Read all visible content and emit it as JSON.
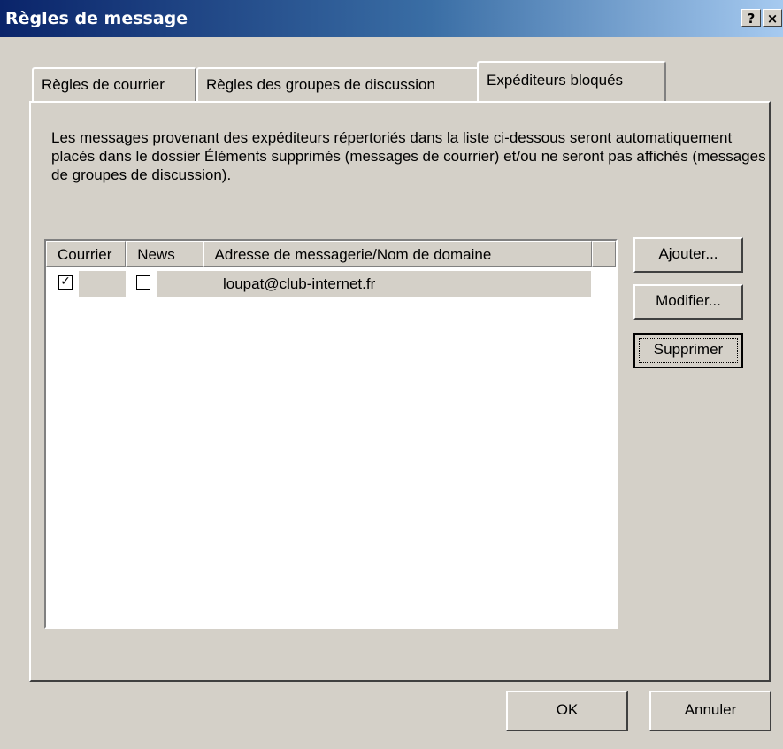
{
  "window": {
    "title": "Règles de message",
    "help_label": "?",
    "close_label": "×"
  },
  "tabs": [
    {
      "label": "Règles de courrier",
      "active": false
    },
    {
      "label": "Règles des groupes de discussion",
      "active": false
    },
    {
      "label": "Expéditeurs bloqués",
      "active": true
    }
  ],
  "description": "Les messages provenant des expéditeurs répertoriés dans la liste ci-dessous seront automatiquement placés dans le dossier Éléments supprimés (messages de courrier) et/ou ne seront pas affichés (messages de groupes de discussion).",
  "list": {
    "columns": [
      "Courrier",
      "News",
      "Adresse de messagerie/Nom de domaine"
    ],
    "rows": [
      {
        "mail_checked": true,
        "news_checked": false,
        "address": "loupat@club-internet.fr"
      }
    ]
  },
  "buttons": {
    "add": "Ajouter...",
    "modify": "Modifier...",
    "delete": "Supprimer",
    "ok": "OK",
    "cancel": "Annuler"
  }
}
